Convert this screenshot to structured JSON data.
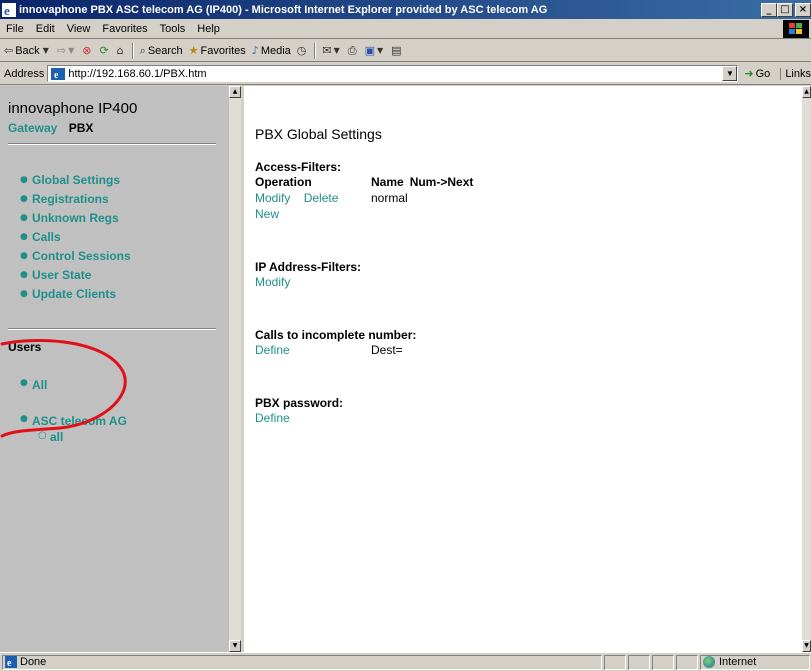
{
  "window": {
    "title": "innovaphone PBX ASC telecom AG (IP400) - Microsoft Internet Explorer provided by ASC telecom AG",
    "minimize": "_",
    "maximize": "□",
    "close": "×"
  },
  "menu": {
    "items": [
      "File",
      "Edit",
      "View",
      "Favorites",
      "Tools",
      "Help"
    ]
  },
  "toolbar": {
    "back": "Back",
    "search": "Search",
    "favorites": "Favorites",
    "media": "Media"
  },
  "address": {
    "label": "Address",
    "url": "http://192.168.60.1/PBX.htm",
    "go": "Go",
    "links": "Links"
  },
  "sidebar": {
    "brand": "innovaphone IP400",
    "gateway": "Gateway",
    "pbx": "PBX",
    "items": [
      {
        "label": "Global Settings"
      },
      {
        "label": "Registrations"
      },
      {
        "label": "Unknown Regs"
      },
      {
        "label": "Calls"
      },
      {
        "label": "Control Sessions"
      },
      {
        "label": "User State"
      },
      {
        "label": "Update Clients"
      }
    ],
    "users_heading": "Users",
    "users_all": "All",
    "org": "ASC telecom AG",
    "org_all": "all"
  },
  "main": {
    "title": "PBX Global Settings",
    "access_filters": {
      "heading": "Access-Filters:",
      "col_operation": "Operation",
      "col_name": "Name",
      "col_numnext": "Num->Next",
      "modify": "Modify",
      "delete": "Delete",
      "name_value": "normal",
      "new": "New"
    },
    "ip_filters": {
      "heading": "IP Address-Filters:",
      "modify": "Modify"
    },
    "incomplete": {
      "heading": "Calls to incomplete number:",
      "define": "Define",
      "dest": "Dest="
    },
    "password": {
      "heading": "PBX password:",
      "define": "Define"
    }
  },
  "status": {
    "text": "Done",
    "zone": "Internet"
  },
  "colors": {
    "link": "#1f8f8a",
    "sidebar_bg": "#c0c0c0",
    "annotation": "#e0101a"
  }
}
